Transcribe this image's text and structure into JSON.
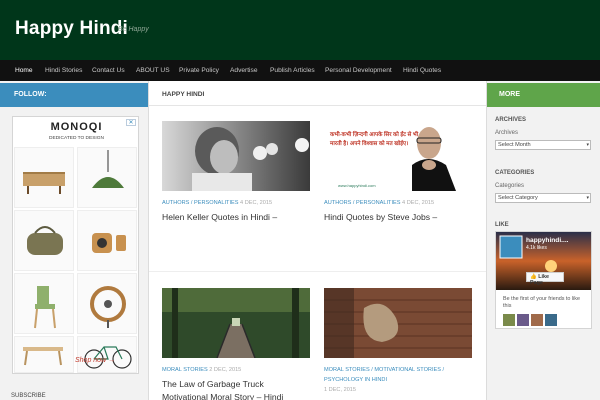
{
  "header": {
    "title": "Happy Hindi",
    "tagline": "Be Happy"
  },
  "nav": {
    "items": [
      {
        "label": "Home",
        "active": true
      },
      {
        "label": "Hindi Stories"
      },
      {
        "label": "Contact Us"
      },
      {
        "label": "ABOUT US"
      },
      {
        "label": "Private Policy"
      },
      {
        "label": "Advertise"
      },
      {
        "label": "Publish Articles"
      },
      {
        "label": "Personal Development"
      },
      {
        "label": "Hindi Quotes"
      }
    ]
  },
  "sidebar_left": {
    "follow_label": "FOLLOW:",
    "ad": {
      "logo": "MONOQI",
      "sub": "DEDICATED TO DESIGN",
      "cta": "Shop now →",
      "close_icon": "close-icon"
    },
    "subscribe_label": "SUBSCRIBE"
  },
  "main": {
    "heading": "HAPPY HINDI",
    "posts": [
      {
        "categories": "AUTHORS / PERSONALITIES",
        "date": "4 DEC, 2015",
        "title": "Helen Keller Quotes in Hindi –"
      },
      {
        "categories": "AUTHORS / PERSONALITIES",
        "date": "4 DEC, 2015",
        "title": "Hindi Quotes by Steve Jobs –",
        "image_text": "कभी-कभी ज़िन्दगी आपके सिर को ईंट से भी मारती है। अपने विश्वास को मत खोईए।",
        "image_url": "www.happyhindi.com"
      },
      {
        "categories": "MORAL STORIES",
        "date": "2 DEC, 2015",
        "title": "The Law of Garbage Truck",
        "title2": "Motivational Moral Story – Hindi"
      },
      {
        "categories": "MORAL STORIES / MOTIVATIONAL STORIES /",
        "categories2": "PSYCHOLOGY IN HINDI",
        "date": "1 DEC, 2015"
      }
    ]
  },
  "sidebar_right": {
    "more_label": "MORE",
    "archives_title": "ARCHIVES",
    "archives_label": "Archives",
    "archives_select": "Select Month",
    "categories_title": "CATEGORIES",
    "categories_label": "Categories",
    "categories_select": "Select Category",
    "like_title": "LIKE",
    "fb": {
      "page_name": "happyhindi....",
      "likes": "4.1k likes",
      "like_button": "Like Page",
      "friends_text": "Be the first of your friends to like this"
    }
  },
  "colors": {
    "header_bg": "#00361a",
    "nav_bg": "#111111",
    "follow_bg": "#3b8dbd",
    "more_bg": "#5fa54a",
    "link": "#3b8dbd"
  }
}
